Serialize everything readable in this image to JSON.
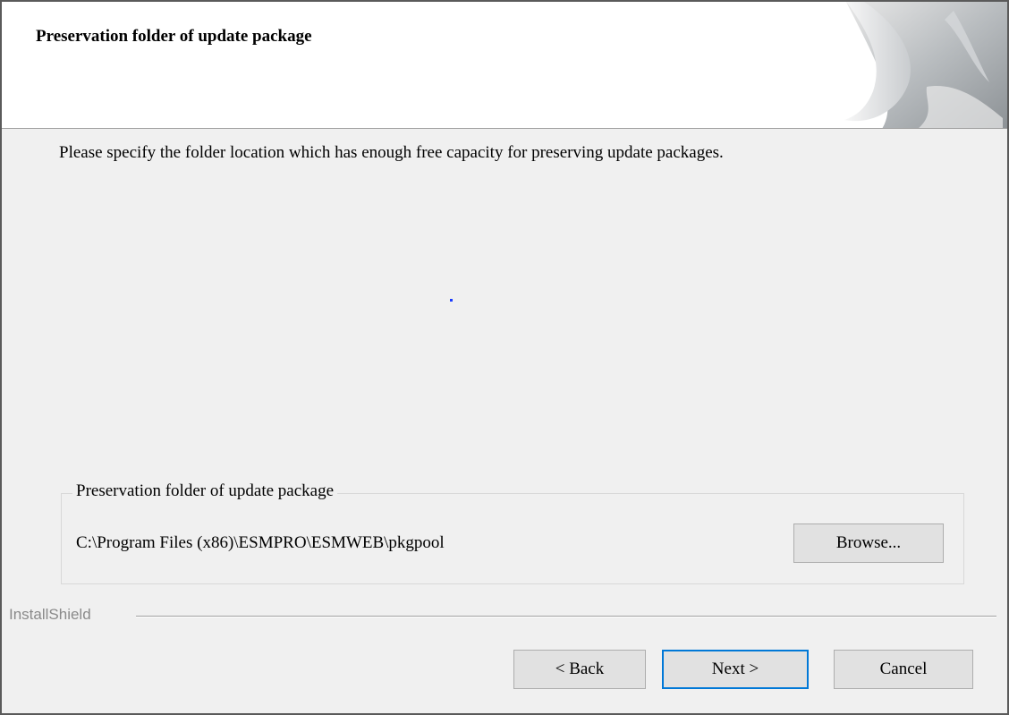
{
  "header": {
    "title": "Preservation folder of update package"
  },
  "description": "Please specify the folder location which has enough free capacity for preserving update packages.",
  "folder_group": {
    "label": "Preservation folder of update package",
    "path": "C:\\Program Files (x86)\\ESMPRO\\ESMWEB\\pkgpool",
    "browse_label": "Browse..."
  },
  "footer": {
    "brand": "InstallShield",
    "back_label": "< Back",
    "next_label": "Next >",
    "cancel_label": "Cancel"
  },
  "colors": {
    "default_button_border": "#0078d7",
    "button_face": "#e1e1e1",
    "dialog_background": "#f0f0f0"
  },
  "icons": {
    "header_graphic": "installshield-page-curl-graphic"
  }
}
